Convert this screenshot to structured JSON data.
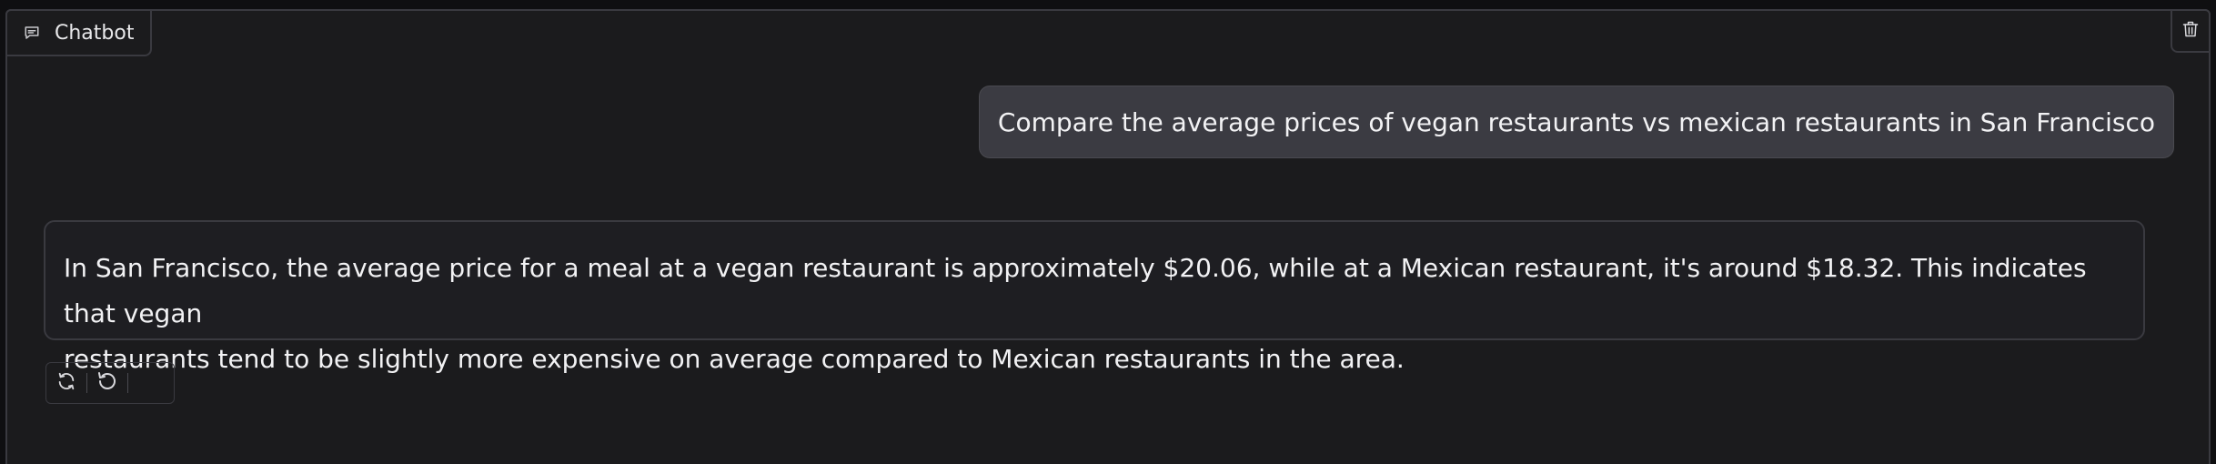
{
  "chatbot": {
    "label": "Chatbot",
    "label_icon": "chat-bubble-icon",
    "clear_icon": "trash-icon"
  },
  "messages": [
    {
      "role": "user",
      "text": "Compare the average prices of vegan restaurants vs mexican restaurants in San Francisco"
    },
    {
      "role": "assistant",
      "lines": [
        "In San Francisco, the average price for a meal at a vegan restaurant is approximately $20.06, while at a Mexican restaurant, it's around $18.32. This indicates that vegan",
        "restaurants tend to be slightly more expensive on average compared to Mexican restaurants in the area."
      ]
    }
  ],
  "actions": {
    "retry_icon": "retry-icon",
    "undo_icon": "undo-icon"
  },
  "colors": {
    "background": "#1b1b1d",
    "border": "#3a3a40",
    "user_bubble": "#3b3b42",
    "text": "#f2f2f4"
  }
}
